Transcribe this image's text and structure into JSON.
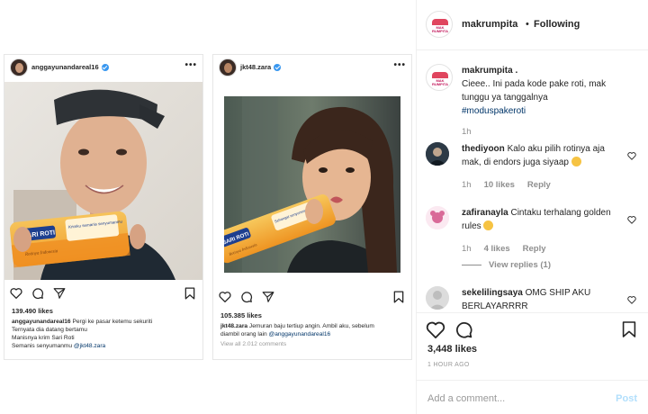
{
  "posts": [
    {
      "username": "anggayunandareal16",
      "likes": "139.490 likes",
      "caption_user": "anggayunandareal16",
      "caption_line1": "Pergi ke pasar ketemu sekuriti",
      "caption_line2": "Ternyata dia datang bertamu",
      "caption_line3": "Manisnya krim Sari Roti",
      "caption_line4": "Semanis senyumanmu",
      "caption_tag": "@jkt48.zara",
      "pack_brand": "SARI ROTI",
      "pack_sub": "Krimku semanis senyumanmu",
      "pack_tag": "Rotinya Indonesia"
    },
    {
      "username": "jkt48.zara",
      "likes": "105.385 likes",
      "caption_user": "jkt48.zara",
      "caption_line1": "Jemuran baju tertiup angin. Ambil aku, sebelum",
      "caption_line2": "diambil orang lain",
      "caption_tag": "@anggayunandareal16",
      "view_all": "View all 2.012 comments",
      "pack_brand": "SARI ROTI",
      "pack_sub": "Sehangat senyummu",
      "pack_tag": "Rotinya Indonesia"
    }
  ],
  "panel": {
    "header_user": "makrumpita",
    "header_dot": "•",
    "header_follow": "Following",
    "avatar_text": "MAK RUMPITA",
    "caption": {
      "user": "makrumpita .",
      "text": "Cieee.. Ini pada kode pake roti, mak tunggu ya tanggalnya",
      "tag": "#moduspakeroti",
      "time": "1h"
    },
    "comments": [
      {
        "user": "thediyoon",
        "text": "Kalo aku pilih rotinya aja mak, di endors juga siyaap",
        "time": "1h",
        "likes": "10 likes",
        "reply": "Reply"
      },
      {
        "user": "zafiranayla",
        "text": "Cintaku terhalang golden rules",
        "time": "1h",
        "likes": "4 likes",
        "reply": "Reply",
        "view_replies": "View replies (1)"
      },
      {
        "user": "sekelilingsaya",
        "text": "OMG SHIP AKU BERLAYARRRR"
      }
    ],
    "likes": "3,448 likes",
    "time_ago": "1 HOUR AGO",
    "add_comment_placeholder": "Add a comment...",
    "post_label": "Post"
  },
  "icons": {
    "heart": "heart-icon",
    "comment": "comment-icon",
    "share": "share-icon",
    "bookmark": "bookmark-icon",
    "more": "more-icon",
    "verified": "verified-badge-icon"
  },
  "colors": {
    "link": "#003569",
    "verified": "#3897f0",
    "post_disabled": "#b2dffc",
    "meta": "#8e8e8e"
  }
}
